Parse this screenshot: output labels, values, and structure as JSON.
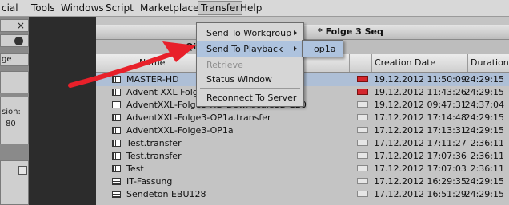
{
  "menubar": {
    "items": [
      {
        "label": "cial"
      },
      {
        "label": "Tools"
      },
      {
        "label": "Windows"
      },
      {
        "label": "Script"
      },
      {
        "label": "Marketplace"
      },
      {
        "label": "Transfer"
      },
      {
        "label": "Help"
      }
    ]
  },
  "left_panel": {
    "close_glyph": "×",
    "labels": [
      "ge",
      "sion:",
      "80"
    ]
  },
  "window": {
    "title": "* Folge 3 Seq",
    "toolbar_text": "Qi"
  },
  "table": {
    "columns": {
      "name": "Name",
      "creation": "Creation Date",
      "duration": "Duration"
    },
    "rows": [
      {
        "name": "MASTER-HD",
        "date": "19.12.2012 11:50:09",
        "duration": "24:29:15",
        "mark": "red",
        "icon": "seq"
      },
      {
        "name": "Advent XXL Folge",
        "date": "19.12.2012 11:43:26",
        "duration": "24:29:15",
        "mark": "red",
        "icon": "seq"
      },
      {
        "name": "AdventXXL-Folge3-HD-DownscaleSD-220",
        "date": "19.12.2012 09:47:31",
        "duration": "24:37:04",
        "mark": "none",
        "icon": "plain"
      },
      {
        "name": "AdventXXL-Folge3-OP1a.transfer",
        "date": "17.12.2012 17:14:48",
        "duration": "24:29:15",
        "mark": "none",
        "icon": "seq"
      },
      {
        "name": "AdventXXL-Folge3-OP1a",
        "date": "17.12.2012 17:13:31",
        "duration": "24:29:15",
        "mark": "none",
        "icon": "seq"
      },
      {
        "name": "Test.transfer",
        "date": "17.12.2012 17:11:27",
        "duration": "2:36:11",
        "mark": "none",
        "icon": "seq"
      },
      {
        "name": "Test.transfer",
        "date": "17.12.2012 17:07:36",
        "duration": "2:36:11",
        "mark": "none",
        "icon": "seq"
      },
      {
        "name": "Test",
        "date": "17.12.2012 17:07:03",
        "duration": "2:36:11",
        "mark": "none",
        "icon": "seq"
      },
      {
        "name": "IT-Fassung",
        "date": "17.12.2012 16:29:35",
        "duration": "24:29:15",
        "mark": "none",
        "icon": "film"
      },
      {
        "name": "Sendeton EBU128",
        "date": "17.12.2012 16:51:29",
        "duration": "24:29:15",
        "mark": "none",
        "icon": "film"
      }
    ]
  },
  "transfer_menu": {
    "items": [
      {
        "label": "Send To Workgroup",
        "submenu": true,
        "state": "normal"
      },
      {
        "label": "Send To Playback",
        "submenu": true,
        "state": "highlighted"
      },
      {
        "label": "Retrieve",
        "submenu": false,
        "state": "disabled"
      },
      {
        "label": "Status Window",
        "submenu": false,
        "state": "normal"
      },
      {
        "label": "Reconnect To Server",
        "submenu": false,
        "state": "normal"
      }
    ]
  },
  "playback_submenu": {
    "items": [
      {
        "label": "op1a"
      }
    ]
  },
  "annotation": {
    "color": "#e8202a"
  }
}
